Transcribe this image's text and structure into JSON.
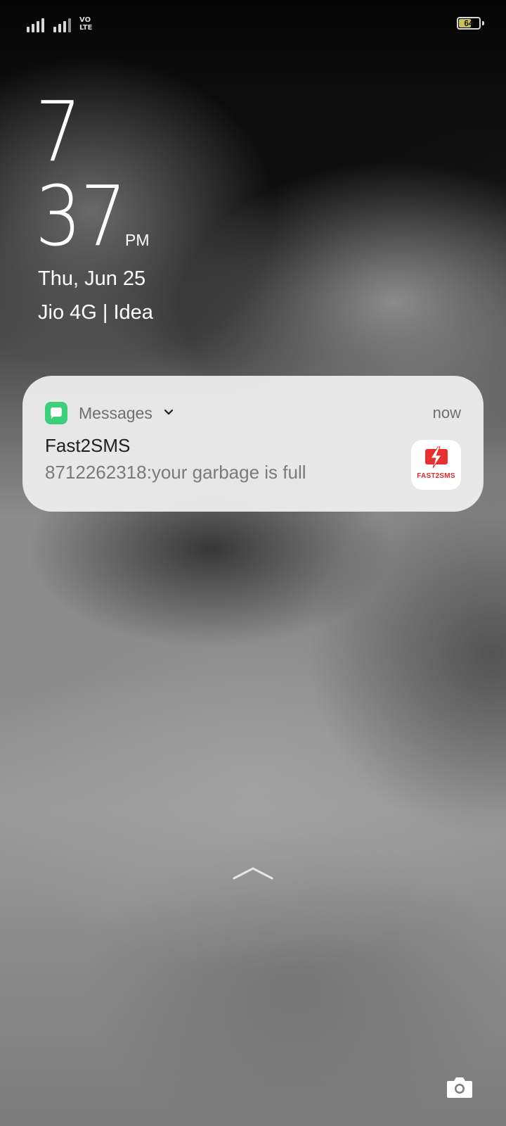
{
  "status_bar": {
    "network_label_line1": "VO",
    "network_label_line2": "LTE",
    "battery_level": "64",
    "icons": [
      "signal-strength-icon",
      "signal-strength-icon",
      "volte-icon",
      "battery-icon"
    ]
  },
  "lockscreen": {
    "hour": "7",
    "minute": "37",
    "ampm": "PM",
    "date": "Thu, Jun 25",
    "carrier": "Jio 4G | Idea"
  },
  "notification": {
    "app_name": "Messages",
    "time": "now",
    "title": "Fast2SMS",
    "body": "8712262318:your garbage is full",
    "sender_logo_text": "FAST2SMS",
    "app_icon_color": "#3ecf7a",
    "logo_accent_color": "#e02a2a"
  },
  "icons": {
    "swipe_up": "chevron-up-icon",
    "camera": "camera-icon"
  }
}
